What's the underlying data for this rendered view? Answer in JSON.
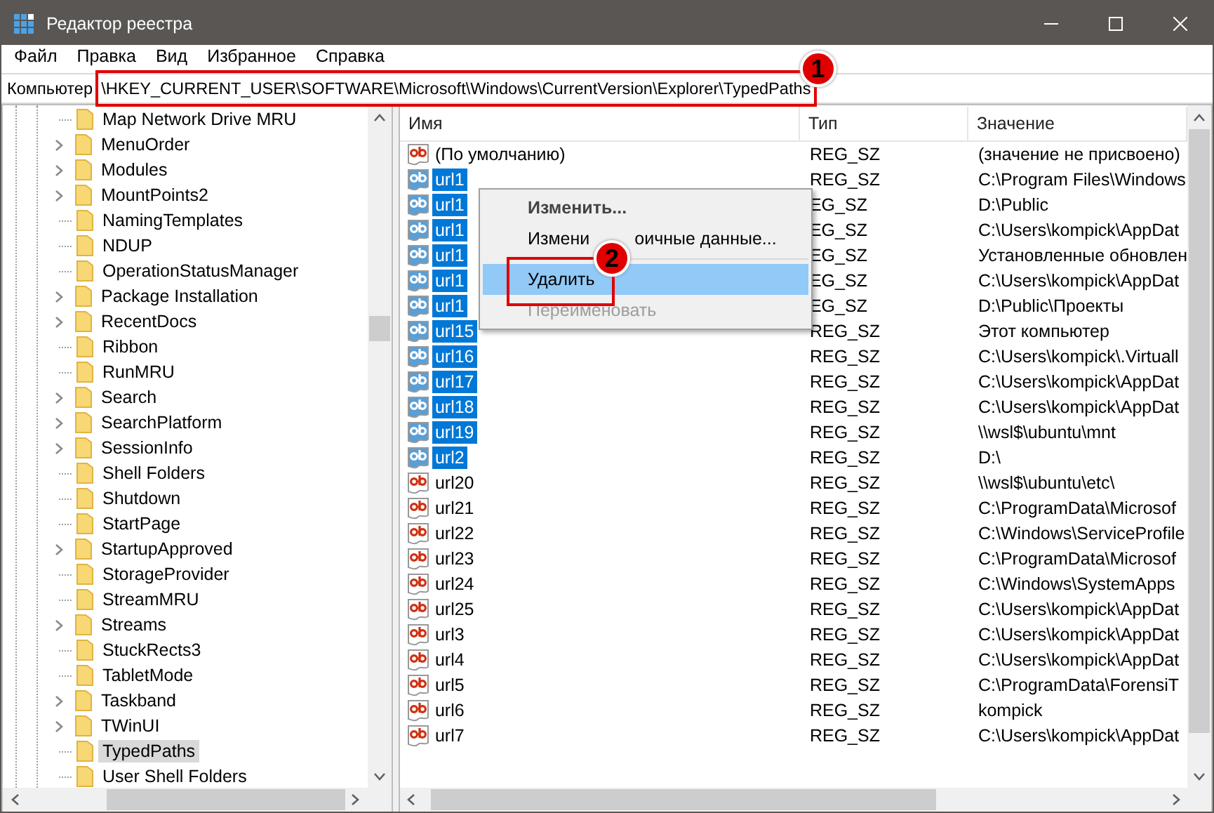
{
  "window": {
    "title": "Редактор реестра"
  },
  "menu": [
    "Файл",
    "Правка",
    "Вид",
    "Избранное",
    "Справка"
  ],
  "address": {
    "root": "Компьютер",
    "path": "\\HKEY_CURRENT_USER\\SOFTWARE\\Microsoft\\Windows\\CurrentVersion\\Explorer\\TypedPaths"
  },
  "tree": {
    "items": [
      {
        "label": "Map Network Drive MRU",
        "expandable": false,
        "selected": false
      },
      {
        "label": "MenuOrder",
        "expandable": true,
        "selected": false
      },
      {
        "label": "Modules",
        "expandable": true,
        "selected": false
      },
      {
        "label": "MountPoints2",
        "expandable": true,
        "selected": false
      },
      {
        "label": "NamingTemplates",
        "expandable": false,
        "selected": false
      },
      {
        "label": "NDUP",
        "expandable": false,
        "selected": false
      },
      {
        "label": "OperationStatusManager",
        "expandable": false,
        "selected": false
      },
      {
        "label": "Package Installation",
        "expandable": true,
        "selected": false
      },
      {
        "label": "RecentDocs",
        "expandable": true,
        "selected": false
      },
      {
        "label": "Ribbon",
        "expandable": false,
        "selected": false
      },
      {
        "label": "RunMRU",
        "expandable": false,
        "selected": false
      },
      {
        "label": "Search",
        "expandable": true,
        "selected": false
      },
      {
        "label": "SearchPlatform",
        "expandable": true,
        "selected": false
      },
      {
        "label": "SessionInfo",
        "expandable": true,
        "selected": false
      },
      {
        "label": "Shell Folders",
        "expandable": false,
        "selected": false
      },
      {
        "label": "Shutdown",
        "expandable": false,
        "selected": false
      },
      {
        "label": "StartPage",
        "expandable": false,
        "selected": false
      },
      {
        "label": "StartupApproved",
        "expandable": true,
        "selected": false
      },
      {
        "label": "StorageProvider",
        "expandable": false,
        "selected": false
      },
      {
        "label": "StreamMRU",
        "expandable": false,
        "selected": false
      },
      {
        "label": "Streams",
        "expandable": true,
        "selected": false
      },
      {
        "label": "StuckRects3",
        "expandable": false,
        "selected": false
      },
      {
        "label": "TabletMode",
        "expandable": false,
        "selected": false
      },
      {
        "label": "Taskband",
        "expandable": true,
        "selected": false
      },
      {
        "label": "TWinUI",
        "expandable": true,
        "selected": false
      },
      {
        "label": "TypedPaths",
        "expandable": false,
        "selected": true
      },
      {
        "label": "User Shell Folders",
        "expandable": false,
        "selected": false
      }
    ]
  },
  "table": {
    "columns": [
      "Имя",
      "Тип",
      "Значение"
    ],
    "rows": [
      {
        "name": "(По умолчанию)",
        "type": "REG_SZ",
        "value": "(значение не присвоено)",
        "selected": false
      },
      {
        "name": "url1",
        "type": "REG_SZ",
        "value": "C:\\Program Files\\Windows",
        "selected": true
      },
      {
        "name": "url1",
        "type": "EG_SZ",
        "value": "D:\\Public",
        "selected": true
      },
      {
        "name": "url1",
        "type": "EG_SZ",
        "value": "C:\\Users\\kompick\\AppDat",
        "selected": true
      },
      {
        "name": "url1",
        "type": "EG_SZ",
        "value": "Установленные обновлен",
        "selected": true
      },
      {
        "name": "url1",
        "type": "EG_SZ",
        "value": "C:\\Users\\kompick\\AppDat",
        "selected": true
      },
      {
        "name": "url1",
        "type": "EG_SZ",
        "value": "D:\\Public\\Проекты",
        "selected": true
      },
      {
        "name": "url15",
        "type": "REG_SZ",
        "value": "Этот компьютер",
        "selected": true
      },
      {
        "name": "url16",
        "type": "REG_SZ",
        "value": "C:\\Users\\kompick\\.Virtuall",
        "selected": true
      },
      {
        "name": "url17",
        "type": "REG_SZ",
        "value": "C:\\Users\\kompick\\AppDat",
        "selected": true
      },
      {
        "name": "url18",
        "type": "REG_SZ",
        "value": "C:\\Users\\kompick\\AppDat",
        "selected": true
      },
      {
        "name": "url19",
        "type": "REG_SZ",
        "value": "\\\\wsl$\\ubuntu\\mnt",
        "selected": true
      },
      {
        "name": "url2",
        "type": "REG_SZ",
        "value": "D:\\",
        "selected": true
      },
      {
        "name": "url20",
        "type": "REG_SZ",
        "value": "\\\\wsl$\\ubuntu\\etc\\",
        "selected": false
      },
      {
        "name": "url21",
        "type": "REG_SZ",
        "value": "C:\\ProgramData\\Microsof",
        "selected": false
      },
      {
        "name": "url22",
        "type": "REG_SZ",
        "value": "C:\\Windows\\ServiceProfile",
        "selected": false
      },
      {
        "name": "url23",
        "type": "REG_SZ",
        "value": "C:\\ProgramData\\Microsof",
        "selected": false
      },
      {
        "name": "url24",
        "type": "REG_SZ",
        "value": "C:\\Windows\\SystemApps",
        "selected": false
      },
      {
        "name": "url25",
        "type": "REG_SZ",
        "value": "C:\\Users\\kompick\\AppDat",
        "selected": false
      },
      {
        "name": "url3",
        "type": "REG_SZ",
        "value": "C:\\Users\\kompick\\AppDat",
        "selected": false
      },
      {
        "name": "url4",
        "type": "REG_SZ",
        "value": "C:\\Users\\kompick\\AppDat",
        "selected": false
      },
      {
        "name": "url5",
        "type": "REG_SZ",
        "value": "C:\\ProgramData\\ForensiT",
        "selected": false
      },
      {
        "name": "url6",
        "type": "REG_SZ",
        "value": "kompick",
        "selected": false
      },
      {
        "name": "url7",
        "type": "REG_SZ",
        "value": "C:\\Users\\kompick\\AppDat",
        "selected": false
      }
    ]
  },
  "context_menu": [
    {
      "kind": "item",
      "label": "Изменить...",
      "default": true,
      "selected": false,
      "disabled": false
    },
    {
      "kind": "covered",
      "parts": [
        "Измени",
        "оичные данные..."
      ],
      "default": false,
      "selected": false,
      "disabled": false
    },
    {
      "kind": "separator"
    },
    {
      "kind": "item",
      "label": "Удалить",
      "default": false,
      "selected": true,
      "disabled": false
    },
    {
      "kind": "item",
      "label": "Переименовать",
      "default": false,
      "selected": false,
      "disabled": true
    }
  ],
  "annotations": [
    {
      "label": "1"
    },
    {
      "label": "2"
    }
  ]
}
